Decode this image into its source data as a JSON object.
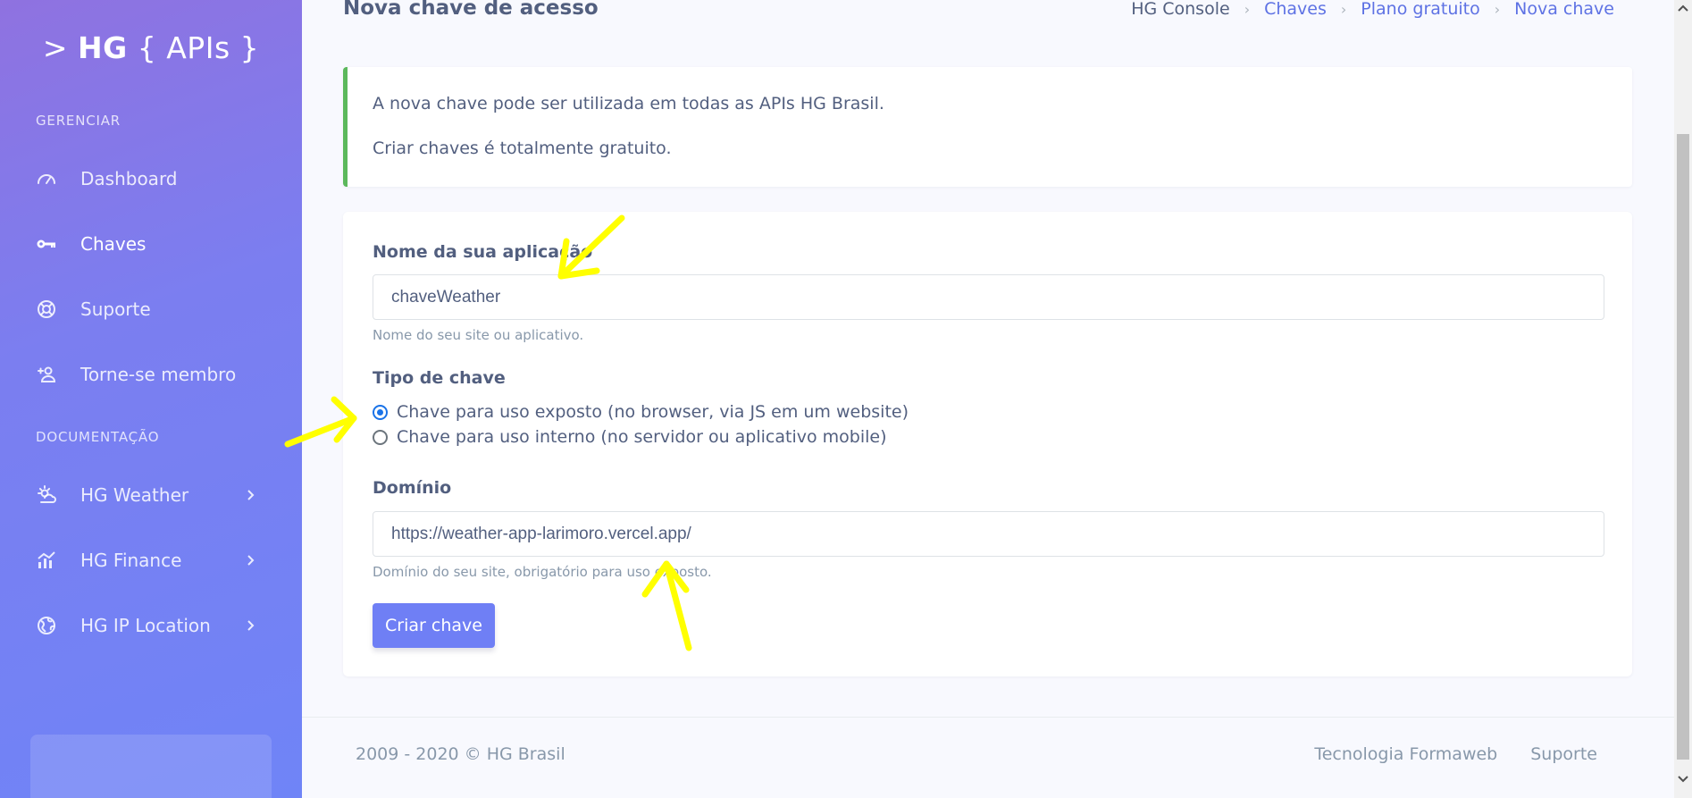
{
  "brand": {
    "prefix": ">",
    "bold": "HG",
    "suffix": "{ APIs }"
  },
  "sidebar": {
    "heading_manage": "GERENCIAR",
    "heading_docs": "DOCUMENTAÇÃO",
    "items": [
      {
        "label": "Dashboard",
        "icon": "gauge-icon"
      },
      {
        "label": "Chaves",
        "icon": "key-icon"
      },
      {
        "label": "Suporte",
        "icon": "lifebuoy-icon"
      },
      {
        "label": "Torne-se membro",
        "icon": "user-plus-icon"
      }
    ],
    "docs": [
      {
        "label": "HG Weather",
        "icon": "weather-icon"
      },
      {
        "label": "HG Finance",
        "icon": "chart-bar-icon"
      },
      {
        "label": "HG IP Location",
        "icon": "globe-icon"
      }
    ]
  },
  "header": {
    "title": "Nova chave de acesso",
    "breadcrumb": [
      "HG Console",
      "Chaves",
      "Plano gratuito",
      "Nova chave"
    ]
  },
  "info": {
    "line1": "A nova chave pode ser utilizada em todas as APIs HG Brasil.",
    "line2": "Criar chaves é totalmente gratuito."
  },
  "form": {
    "name_label": "Nome da sua aplicação",
    "name_value": "chaveWeather",
    "name_help": "Nome do seu site ou aplicativo.",
    "type_label": "Tipo de chave",
    "type_options": [
      {
        "label": "Chave para uso exposto (no browser, via JS em um website)",
        "checked": true
      },
      {
        "label": "Chave para uso interno (no servidor ou aplicativo mobile)",
        "checked": false
      }
    ],
    "domain_label": "Domínio",
    "domain_value": "https://weather-app-larimoro.vercel.app/",
    "domain_help": "Domínio do seu site, obrigatório para uso exposto.",
    "submit_label": "Criar chave"
  },
  "footer": {
    "copyright": "2009 - 2020 © HG Brasil",
    "links": [
      "Tecnologia Formaweb",
      "Suporte"
    ]
  },
  "colors": {
    "sidebar_gradient_start": "#8f72e0",
    "sidebar_gradient_end": "#6f84f7",
    "accent": "#5e72e4",
    "success_border": "#5cb85c",
    "button": "#6f7ff5",
    "annotation_arrow": "#ffff00"
  }
}
